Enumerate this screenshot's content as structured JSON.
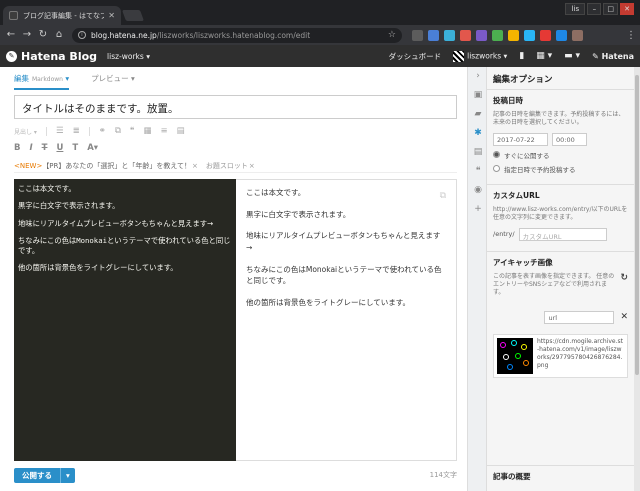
{
  "browser": {
    "tab_title": "ブログ記事編集 - はてなブ",
    "tab_close": "✕",
    "user": "lis",
    "url_host": "blog.hatena.ne.jp",
    "url_path": "/liszworks/liszworks.hatenablog.com/edit"
  },
  "header": {
    "logo_text": "Hatena Blog",
    "blog_name": "lisz-works ▾",
    "dashboard": "ダッシュボード",
    "user_name": "liszworks ▾",
    "hatena": "Hatena"
  },
  "editor": {
    "tab_edit": "編集",
    "tab_edit_mode": "Markdown",
    "tab_preview": "プレビュー",
    "title_value": "タイトルはそのままです。放置。",
    "heading_label": "見出し",
    "tags": {
      "new_label": "<NEW>",
      "pr_label": "【PR】あなたの「選択」と「年齢」を教えて！",
      "slot_label": "お題スロット",
      "x": "×"
    },
    "lines": [
      "ここは本文です。",
      "黒字に白文字で表示されます。",
      "地味にリアルタイムプレビューボタンもちゃんと見えます→",
      "ちなみにこの色は",
      "Monokai",
      "というテーマで使われている色と同じです。",
      "他の箇所は背景色をライトグレーにしています。"
    ],
    "preview_lines": [
      "ここは本文です。",
      "黒字に白文字で表示されます。",
      "地味にリアルタイムプレビューボタンもちゃんと見えます→",
      "ちなみにこの色はMonokaiというテーマで使われている色と同じです。",
      "他の箇所は背景色をライトグレーにしています。"
    ],
    "publish_label": "公開する",
    "char_count": "114文字"
  },
  "sidebar": {
    "title": "編集オプション",
    "post_date": {
      "heading": "投稿日時",
      "desc": "記事の日時を編集できます。予約投稿するには、未来の日時を選択してください。",
      "date": "2017-07-22",
      "time": "00:00",
      "opt_now": "すぐに公開する",
      "opt_schedule": "指定日時で予約投稿する"
    },
    "custom_url": {
      "heading": "カスタムURL",
      "desc": "http://www.lisz-works.com/entry/以下のURLを任意の文字列に変更できます。",
      "prefix": "/entry/",
      "placeholder": "カスタムURL"
    },
    "eyecatch": {
      "heading": "アイキャッチ画像",
      "desc": "この記事を表す画像を指定できます。 任意のエントリーやSNSシェアなどで利用されます。",
      "url_value": "url",
      "image_name": "https://cdn.mogile.archive.st-hatena.com/v1/image/liszworks/297795780426876284.png"
    },
    "summary_heading": "記事の概要"
  },
  "colors": {
    "accent": "#2a8fc9",
    "editor_bg": "#272822",
    "new_tag": "#e87a00"
  }
}
